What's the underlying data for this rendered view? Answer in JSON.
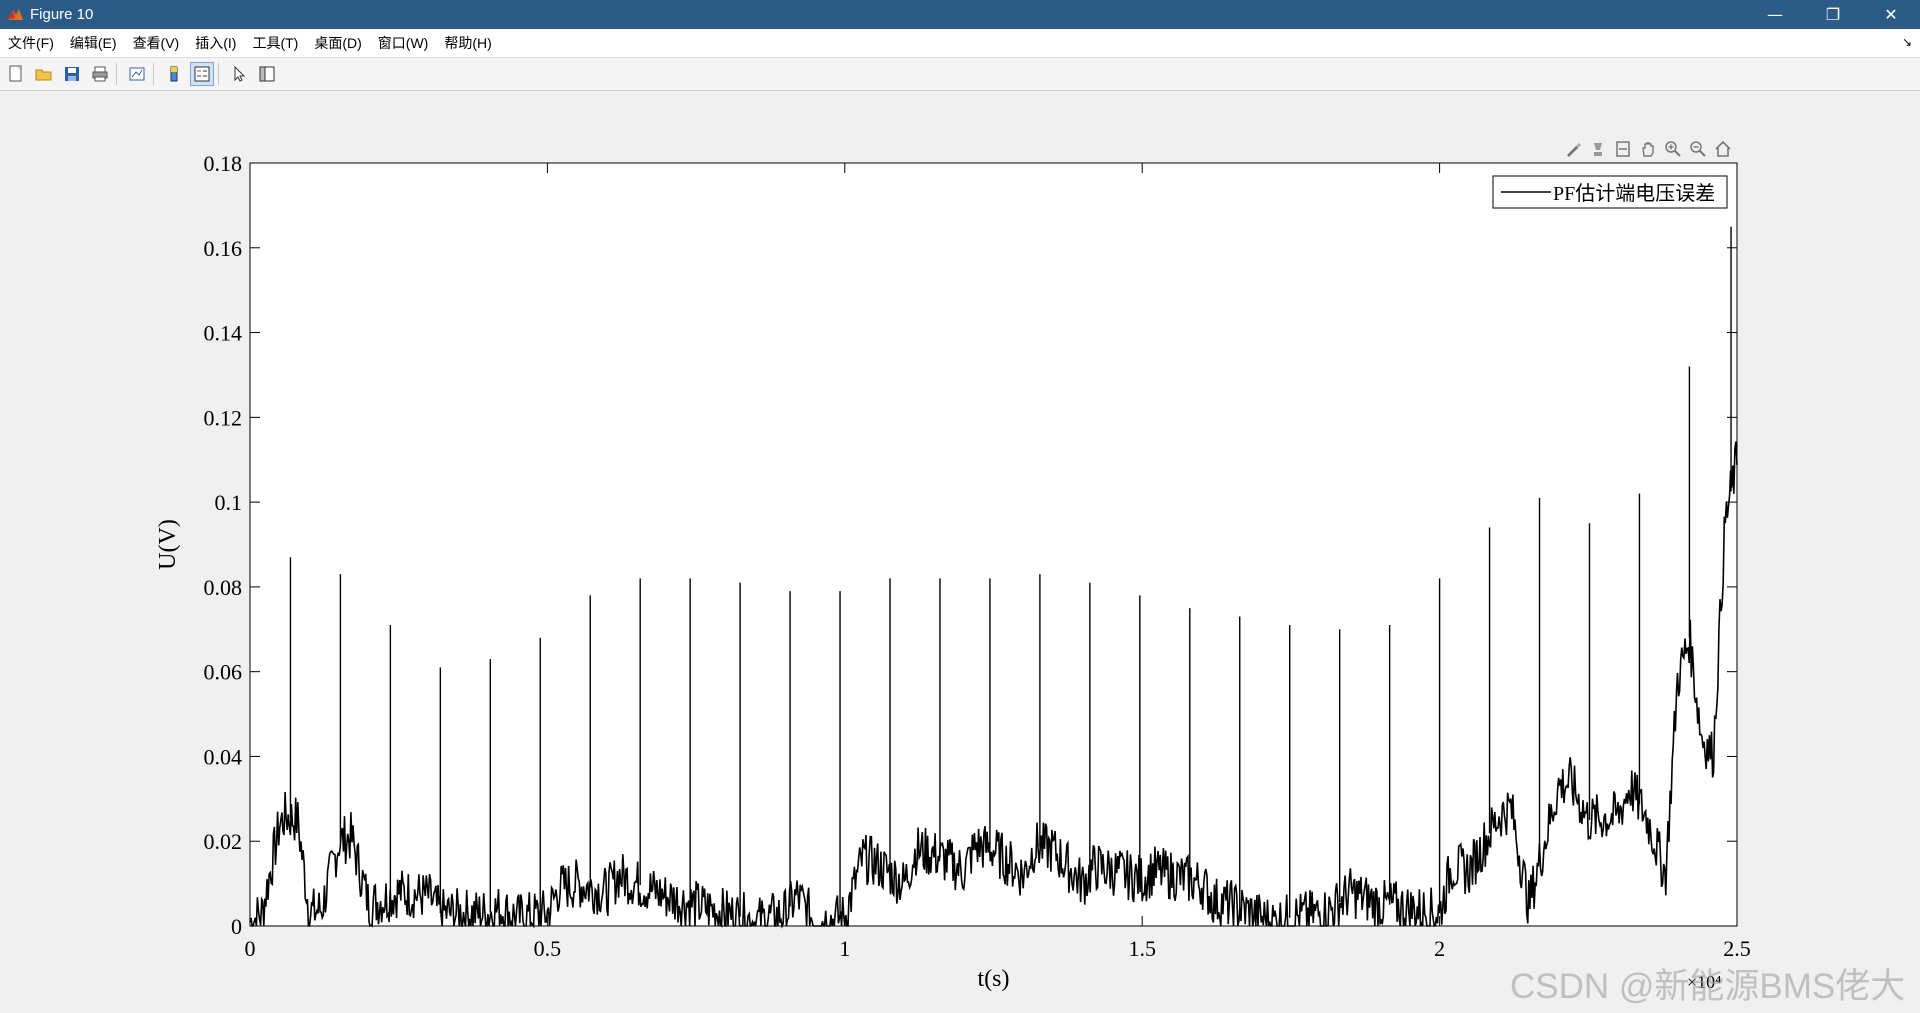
{
  "window": {
    "title": "Figure 10",
    "minimize": "—",
    "restore": "❐",
    "close": "✕"
  },
  "menubar": {
    "items": [
      "文件(F)",
      "编辑(E)",
      "查看(V)",
      "插入(I)",
      "工具(T)",
      "桌面(D)",
      "窗口(W)",
      "帮助(H)"
    ],
    "dock_arrow": "↘"
  },
  "toolbar": {
    "buttons": [
      "new-figure-icon",
      "open-icon",
      "save-icon",
      "print-icon",
      "link-plot-icon",
      "colorbar-icon",
      "legend-icon",
      "pointer-icon",
      "property-inspector-icon"
    ]
  },
  "axes_toolbar": {
    "buttons": [
      "brush-icon",
      "data-tips-icon",
      "restore-view-icon",
      "pan-icon",
      "zoom-in-icon",
      "zoom-out-icon",
      "home-icon"
    ]
  },
  "watermark": "CSDN @新能源BMS佬大",
  "chart_data": {
    "type": "line",
    "xlabel": "t(s)",
    "ylabel": "U(V)",
    "x_exponent_label": "×10⁴",
    "xlim": [
      0,
      2.5
    ],
    "ylim": [
      0,
      0.18
    ],
    "xticks": [
      "0",
      "0.5",
      "1",
      "1.5",
      "2",
      "2.5"
    ],
    "yticks": [
      "0",
      "0.02",
      "0.04",
      "0.06",
      "0.08",
      "0.1",
      "0.12",
      "0.14",
      "0.16",
      "0.18"
    ],
    "legend_position": "top-right",
    "line_color": "#000000",
    "series": [
      {
        "name": "PF估计端电压误差",
        "x": [
          0.0,
          0.02,
          0.05,
          0.06,
          0.08,
          0.1,
          0.12,
          0.15,
          0.17,
          0.2,
          0.22,
          0.25,
          0.3,
          0.32,
          0.35,
          0.4,
          0.42,
          0.45,
          0.5,
          0.52,
          0.55,
          0.6,
          0.62,
          0.65,
          0.7,
          0.72,
          0.75,
          0.8,
          0.83,
          0.85,
          0.9,
          0.92,
          0.95,
          1.0,
          1.03,
          1.05,
          1.1,
          1.12,
          1.15,
          1.2,
          1.22,
          1.25,
          1.3,
          1.32,
          1.35,
          1.4,
          1.42,
          1.45,
          1.5,
          1.52,
          1.55,
          1.6,
          1.62,
          1.65,
          1.7,
          1.72,
          1.75,
          1.8,
          1.82,
          1.85,
          1.9,
          1.92,
          1.95,
          2.0,
          2.02,
          2.05,
          2.1,
          2.12,
          2.15,
          2.2,
          2.22,
          2.25,
          2.3,
          2.32,
          2.35,
          2.38,
          2.4,
          2.42,
          2.44,
          2.46,
          2.48,
          2.5
        ],
        "y": [
          0.001,
          0.003,
          0.024,
          0.026,
          0.025,
          0.003,
          0.004,
          0.02,
          0.021,
          0.005,
          0.006,
          0.008,
          0.007,
          0.003,
          0.003,
          0.003,
          0.004,
          0.002,
          0.003,
          0.009,
          0.01,
          0.008,
          0.012,
          0.01,
          0.007,
          0.006,
          0.005,
          0.003,
          0.002,
          0.001,
          0.003,
          0.007,
          0.001,
          0.002,
          0.016,
          0.015,
          0.01,
          0.018,
          0.017,
          0.013,
          0.019,
          0.018,
          0.012,
          0.019,
          0.018,
          0.01,
          0.014,
          0.013,
          0.011,
          0.013,
          0.012,
          0.01,
          0.006,
          0.005,
          0.002,
          0.001,
          0.002,
          0.003,
          0.004,
          0.008,
          0.005,
          0.005,
          0.004,
          0.003,
          0.014,
          0.013,
          0.026,
          0.028,
          0.005,
          0.033,
          0.034,
          0.025,
          0.026,
          0.033,
          0.025,
          0.012,
          0.058,
          0.068,
          0.045,
          0.04,
          0.095,
          0.11
        ]
      }
    ],
    "spikes": {
      "x": [
        0.068,
        0.152,
        0.236,
        0.32,
        0.404,
        0.488,
        0.572,
        0.656,
        0.74,
        0.824,
        0.908,
        0.992,
        1.076,
        1.16,
        1.244,
        1.328,
        1.412,
        1.496,
        1.58,
        1.664,
        1.748,
        1.832,
        1.916,
        2.0,
        2.084,
        2.168,
        2.252,
        2.336,
        2.42,
        2.49
      ],
      "y": [
        0.087,
        0.083,
        0.071,
        0.061,
        0.063,
        0.068,
        0.078,
        0.082,
        0.082,
        0.081,
        0.079,
        0.079,
        0.082,
        0.082,
        0.082,
        0.083,
        0.081,
        0.078,
        0.075,
        0.073,
        0.071,
        0.07,
        0.071,
        0.082,
        0.094,
        0.101,
        0.095,
        0.102,
        0.132,
        0.165
      ]
    }
  }
}
